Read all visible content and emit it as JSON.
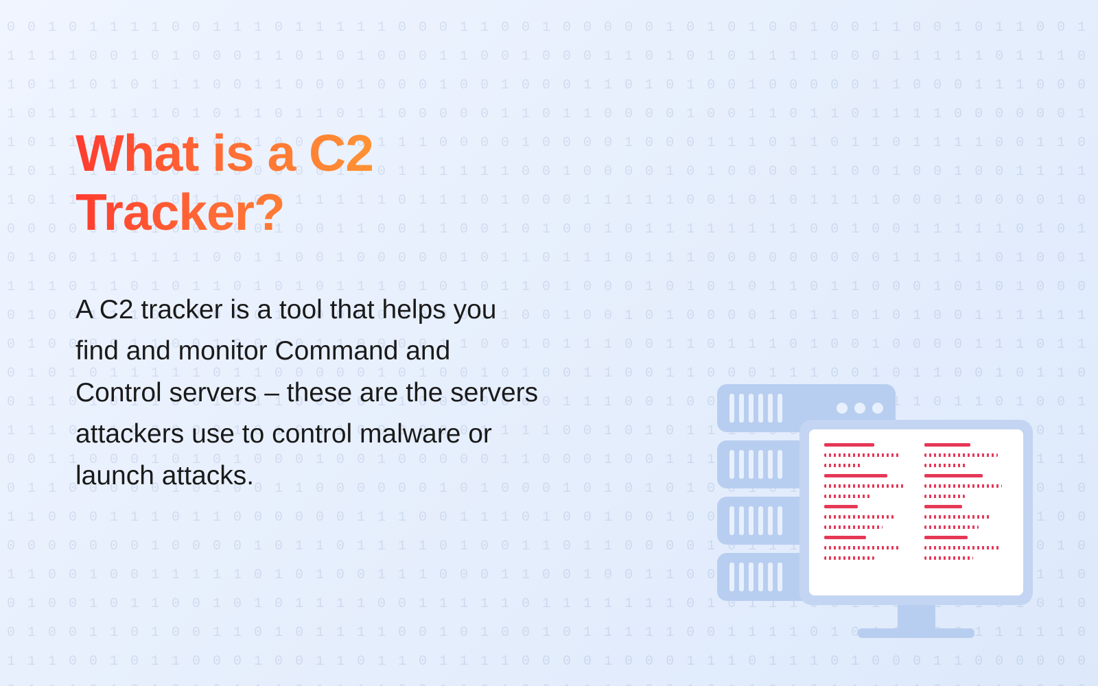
{
  "title": "What is a C2 Tracker?",
  "body": "A C2 tracker is a tool that helps you find and monitor Command and Control servers – these are the servers attackers use to control malware or launch attacks.",
  "colors": {
    "gradient_start": "#ff3b30",
    "gradient_end": "#ffab33",
    "bg_light": "#f0f5ff",
    "server_fill": "#b8cef0",
    "code_red": "#e63757"
  },
  "illustration": {
    "server_units": 4,
    "server_lines_per_unit": 6,
    "server_dots_per_unit": 3,
    "monitor_code_columns": 2
  }
}
